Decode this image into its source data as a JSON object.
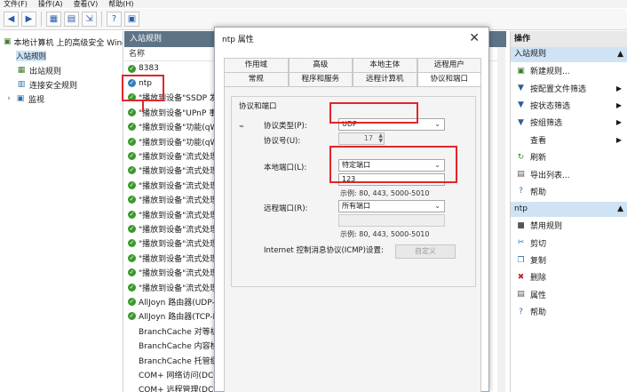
{
  "menu": [
    "文件(F)",
    "操作(A)",
    "查看(V)",
    "帮助(H)"
  ],
  "toolbar": {
    "icons": [
      "back-icon",
      "forward-icon",
      "panel-icon",
      "list-icon",
      "export-icon",
      "help-icon",
      "view-icon"
    ],
    "help_glyph": "?"
  },
  "tree": {
    "root": "本地计算机 上的高级安全 Windows Defender 防火墙",
    "items": [
      "入站规则",
      "出站规则",
      "连接安全规则",
      "监视"
    ]
  },
  "middle": {
    "header": "入站规则",
    "column_name": "名称",
    "rules": [
      {
        "name": "8383",
        "status": "green"
      },
      {
        "name": "ntp",
        "status": "blue"
      },
      {
        "name": "\"播放到设备\"SSDP 发现",
        "status": "green"
      },
      {
        "name": "\"播放到设备\"UPnP 事件",
        "status": "green"
      },
      {
        "name": "\"播放到设备\"功能(qWave)",
        "status": "green"
      },
      {
        "name": "\"播放到设备\"功能(qWave)",
        "status": "green"
      },
      {
        "name": "\"播放到设备\"流式处理服务器",
        "status": "green"
      },
      {
        "name": "\"播放到设备\"流式处理服务器",
        "status": "green"
      },
      {
        "name": "\"播放到设备\"流式处理服务器",
        "status": "green"
      },
      {
        "name": "\"播放到设备\"流式处理服务器",
        "status": "green"
      },
      {
        "name": "\"播放到设备\"流式处理服务器",
        "status": "green"
      },
      {
        "name": "\"播放到设备\"流式处理服务器",
        "status": "green"
      },
      {
        "name": "\"播放到设备\"流式处理服务器",
        "status": "green"
      },
      {
        "name": "\"播放到设备\"流式处理服务器",
        "status": "green"
      },
      {
        "name": "\"播放到设备\"流式处理服务器",
        "status": "green"
      },
      {
        "name": "\"播放到设备\"流式处理服务器",
        "status": "green"
      },
      {
        "name": "AllJoyn 路由器(UDP-In)",
        "status": "green"
      },
      {
        "name": "AllJoyn 路由器(TCP-In)",
        "status": "green"
      },
      {
        "name": "BranchCache 对等机发现",
        "status": "none"
      },
      {
        "name": "BranchCache 内容检索",
        "status": "none"
      },
      {
        "name": "BranchCache 托管缓存服务器",
        "status": "none"
      },
      {
        "name": "COM+ 网络访问(DCOM-In)",
        "status": "none"
      },
      {
        "name": "COM+ 远程管理(DCOM-In)",
        "status": "none"
      }
    ]
  },
  "actions": {
    "header": "操作",
    "section1": "入站规则",
    "items1": [
      {
        "label": "新建规则...",
        "icon": "new-rule-icon",
        "glyph": "▣",
        "arrow": ""
      },
      {
        "label": "按配置文件筛选",
        "icon": "filter-icon",
        "glyph": "▼",
        "arrow": "▶"
      },
      {
        "label": "按状态筛选",
        "icon": "filter-icon",
        "glyph": "▼",
        "arrow": "▶"
      },
      {
        "label": "按组筛选",
        "icon": "filter-icon",
        "glyph": "▼",
        "arrow": "▶"
      },
      {
        "label": "查看",
        "icon": "view-icon",
        "glyph": "",
        "arrow": "▶"
      },
      {
        "label": "刷新",
        "icon": "refresh-icon",
        "glyph": "↻",
        "arrow": ""
      },
      {
        "label": "导出列表...",
        "icon": "export-icon",
        "glyph": "▤",
        "arrow": ""
      },
      {
        "label": "帮助",
        "icon": "help-icon",
        "glyph": "?",
        "arrow": ""
      }
    ],
    "section2": "ntp",
    "items2": [
      {
        "label": "禁用规则",
        "icon": "disable-icon",
        "glyph": "■",
        "arrow": ""
      },
      {
        "label": "剪切",
        "icon": "cut-icon",
        "glyph": "✂",
        "arrow": ""
      },
      {
        "label": "复制",
        "icon": "copy-icon",
        "glyph": "❐",
        "arrow": ""
      },
      {
        "label": "删除",
        "icon": "delete-icon",
        "glyph": "✖",
        "arrow": ""
      },
      {
        "label": "属性",
        "icon": "properties-icon",
        "glyph": "▤",
        "arrow": ""
      },
      {
        "label": "帮助",
        "icon": "help-icon",
        "glyph": "?",
        "arrow": ""
      }
    ]
  },
  "dialog": {
    "title": "ntp 属性",
    "close": "✕",
    "tabs_row1": [
      "作用域",
      "高级",
      "本地主体",
      "远程用户"
    ],
    "tabs_row2": [
      "常规",
      "程序和服务",
      "远程计算机",
      "协议和端口"
    ],
    "group_title": "协议和端口",
    "protocol_type_label": "协议类型(P):",
    "protocol_type_value": "UDP",
    "protocol_number_label": "协议号(U):",
    "protocol_number_value": "17",
    "local_port_label": "本地端口(L):",
    "local_port_value": "特定端口",
    "local_port_input": "123",
    "local_port_example": "示例: 80, 443, 5000-5010",
    "remote_port_label": "远程端口(R):",
    "remote_port_value": "所有端口",
    "remote_port_example": "示例: 80, 443, 5000-5010",
    "icmp_label": "Internet 控制消息协议(ICMP)设置:",
    "custom_button": "自定义"
  }
}
